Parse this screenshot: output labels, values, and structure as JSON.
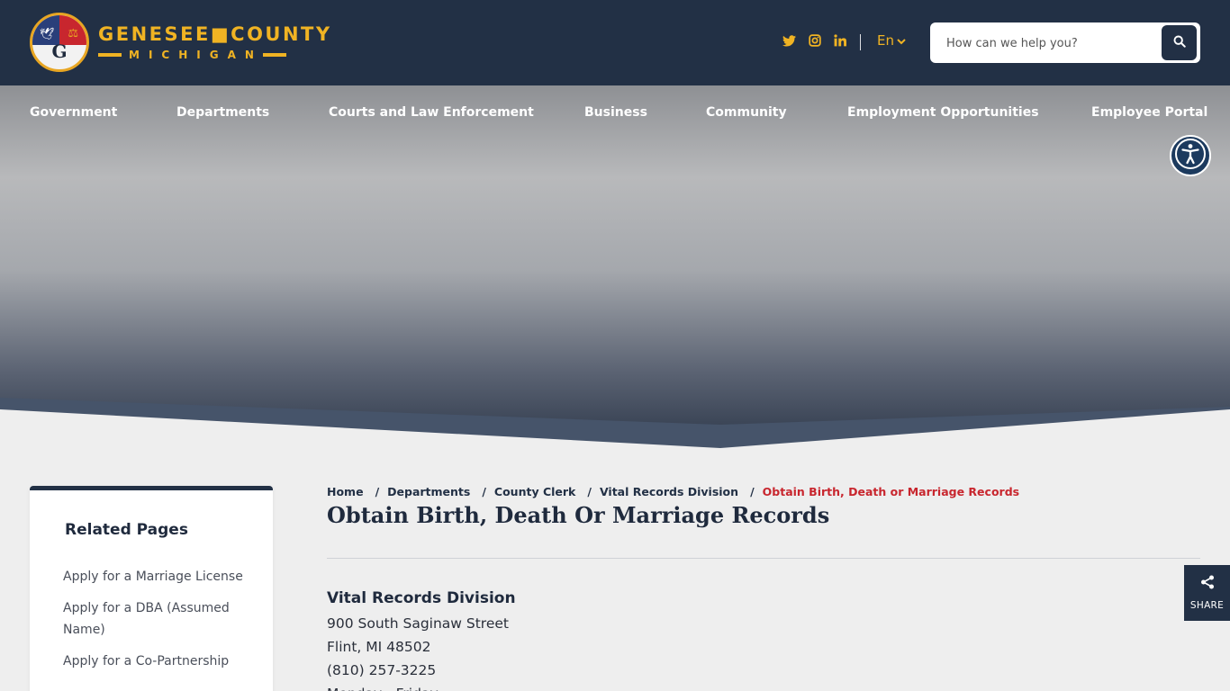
{
  "header": {
    "brand_name": "GENESEE■COUNTY",
    "brand_sub": "MICHIGAN",
    "seal_letter": "G",
    "social": [
      {
        "icon": "twitter-icon",
        "glyph": "🐦︎"
      },
      {
        "icon": "instagram-icon",
        "glyph": "◙"
      },
      {
        "icon": "linkedin-icon",
        "glyph": "in"
      }
    ],
    "language": "En",
    "search_placeholder": "How can we help you?"
  },
  "nav": {
    "items": [
      "Government",
      "Departments",
      "Courts and Law Enforcement",
      "Business",
      "Community",
      "Employment Opportunities",
      "Employee Portal"
    ]
  },
  "sidebar": {
    "title": "Related Pages",
    "links": [
      "Apply for a Marriage License",
      "Apply for a DBA (Assumed Name)",
      "Apply for a Co-Partnership"
    ]
  },
  "breadcrumb": {
    "items": [
      "Home",
      "Departments",
      "County Clerk",
      "Vital Records Division"
    ],
    "current": "Obtain Birth, Death or Marriage Records"
  },
  "page": {
    "title": "Obtain Birth, Death Or Marriage Records",
    "address_heading": "Vital Records Division",
    "address_lines": [
      "900 South Saginaw Street",
      "Flint, MI  48502",
      "(810) 257-3225",
      "Monday - Friday"
    ]
  },
  "share": {
    "label": "SHARE"
  },
  "colors": {
    "navy": "#223045",
    "gold": "#f0b323",
    "red": "#c8262e"
  }
}
